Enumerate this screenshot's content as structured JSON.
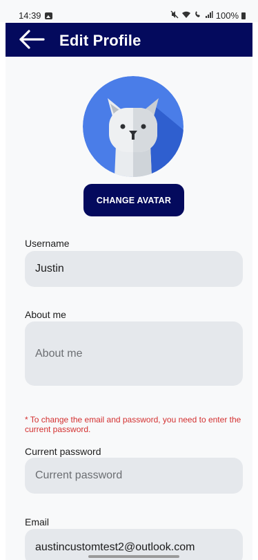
{
  "status_bar": {
    "time": "14:39",
    "battery": "100%",
    "icons": [
      "image-icon",
      "mute-icon",
      "wifi-icon",
      "volte-icon",
      "signal-icon",
      "battery-icon"
    ]
  },
  "app_bar": {
    "title": "Edit Profile",
    "back_icon": "arrow-left-icon",
    "background": "#040a5d"
  },
  "avatar": {
    "icon": "cat-avatar",
    "background": "#4a7de8"
  },
  "change_avatar_button": "CHANGE AVATAR",
  "form": {
    "username": {
      "label": "Username",
      "value": "Justin"
    },
    "about_me": {
      "label": "About me",
      "placeholder": "About me"
    },
    "note": "* To change the email and password, you need to enter the current password.",
    "current_password": {
      "label": "Current password",
      "placeholder": "Current password"
    },
    "email": {
      "label": "Email",
      "value": "austincustomtest2@outlook.com"
    }
  },
  "colors": {
    "primary": "#040a5d",
    "field_bg": "#e5e8ec",
    "warning": "#d32f2f"
  }
}
